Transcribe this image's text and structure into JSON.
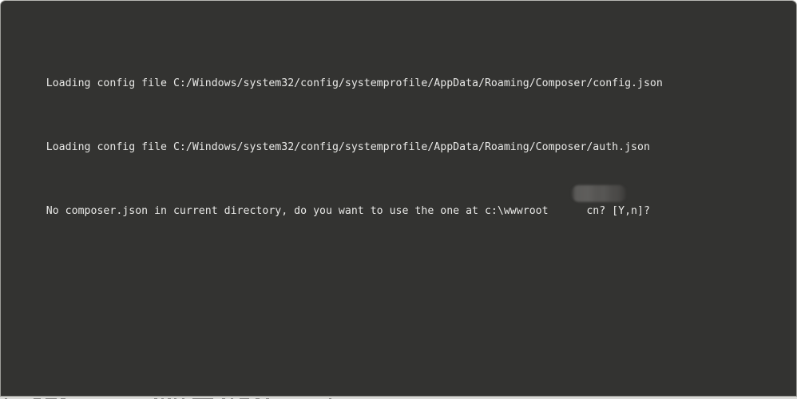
{
  "window": {
    "type": "terminal-console",
    "background_color": "#333331",
    "text_color": "#e8e8e6",
    "border_color": "#b9b9b5"
  },
  "console": {
    "lines": [
      {
        "id": "line-config-json",
        "text": "Loading config file C:/Windows/system32/config/systemprofile/AppData/Roaming/Composer/config.json",
        "redacted": false
      },
      {
        "id": "line-auth-json",
        "text": "Loading config file C:/Windows/system32/config/systemprofile/AppData/Roaming/Composer/auth.json",
        "redacted": false
      },
      {
        "id": "line-composer-prompt",
        "text": "No composer.json in current directory, do you want to use the one at c:\\wwwroot",
        "text_after_redaction": "cn? [Y,n]?",
        "redacted": true,
        "redaction_color": "#575654"
      }
    ]
  },
  "taskbar": {
    "visible": true,
    "background_color": "#d9d9d6"
  }
}
